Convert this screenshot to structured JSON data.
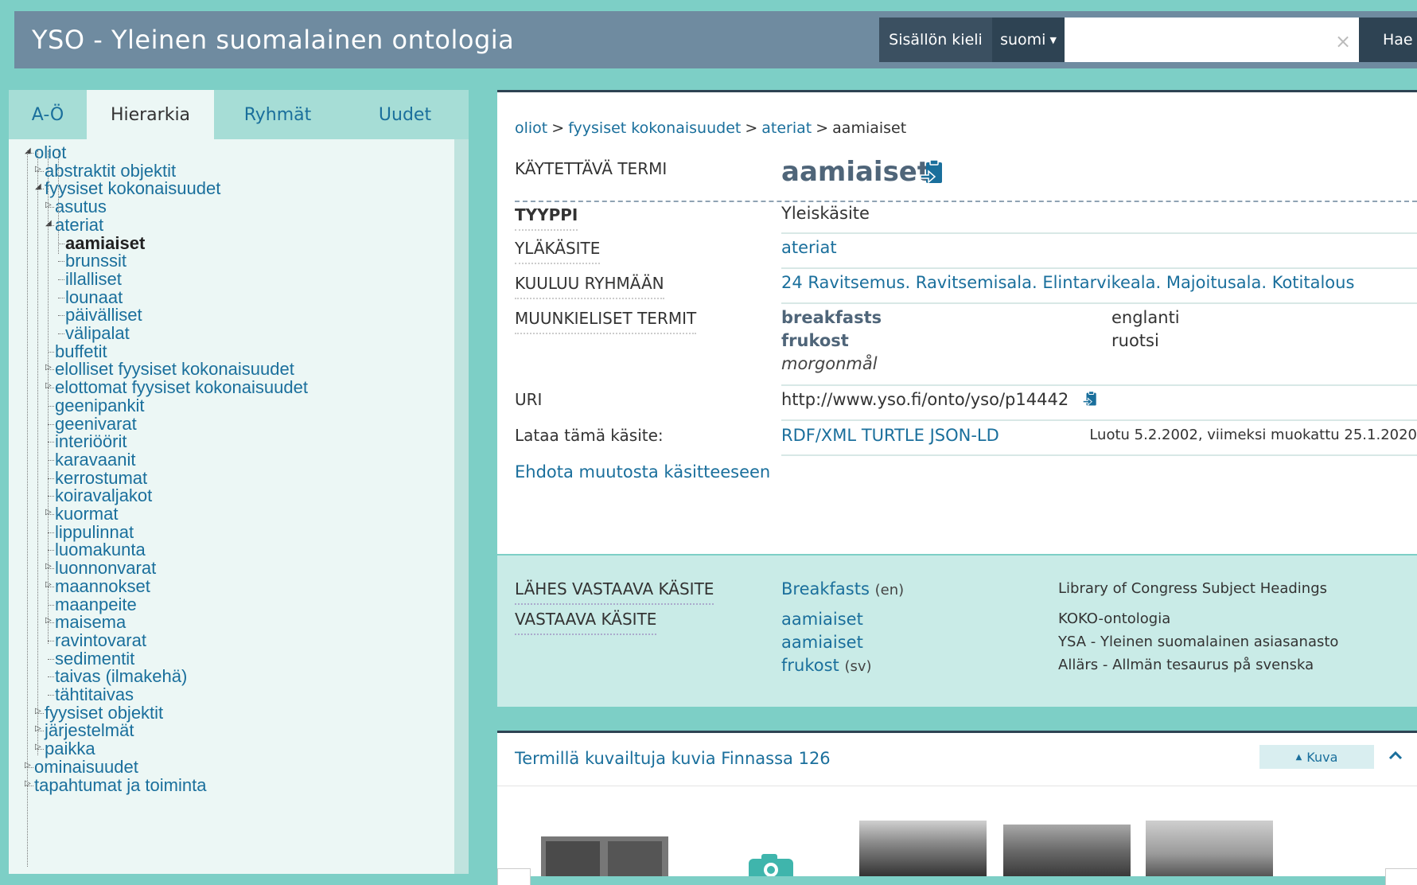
{
  "header": {
    "title": "YSO - Yleinen suomalainen ontologia",
    "content_lang_label": "Sisällön kieli",
    "content_lang_value": "suomi",
    "search_placeholder": "",
    "search_button": "Hae",
    "clear_symbol": "×"
  },
  "sidebar": {
    "tabs": [
      {
        "label": "A-Ö",
        "active": false
      },
      {
        "label": "Hierarkia",
        "active": true
      },
      {
        "label": "Ryhmät",
        "active": false
      },
      {
        "label": "Uudet",
        "active": false
      }
    ],
    "tree": [
      {
        "label": "oliot",
        "level": 0,
        "toggle": "open"
      },
      {
        "label": "abstraktit objektit",
        "level": 1,
        "toggle": "closed"
      },
      {
        "label": "fyysiset kokonaisuudet",
        "level": 1,
        "toggle": "open"
      },
      {
        "label": "asutus",
        "level": 2,
        "toggle": "closed"
      },
      {
        "label": "ateriat",
        "level": 2,
        "toggle": "open"
      },
      {
        "label": "aamiaiset",
        "level": 3,
        "selected": true
      },
      {
        "label": "brunssit",
        "level": 3
      },
      {
        "label": "illalliset",
        "level": 3
      },
      {
        "label": "lounaat",
        "level": 3
      },
      {
        "label": "päivälliset",
        "level": 3
      },
      {
        "label": "välipalat",
        "level": 3
      },
      {
        "label": "buffetit",
        "level": 2
      },
      {
        "label": "elolliset fyysiset kokonaisuudet",
        "level": 2,
        "toggle": "closed"
      },
      {
        "label": "elottomat fyysiset kokonaisuudet",
        "level": 2,
        "toggle": "closed"
      },
      {
        "label": "geenipankit",
        "level": 2
      },
      {
        "label": "geenivarat",
        "level": 2
      },
      {
        "label": "interiöörit",
        "level": 2
      },
      {
        "label": "karavaanit",
        "level": 2
      },
      {
        "label": "kerrostumat",
        "level": 2
      },
      {
        "label": "koiravaljakot",
        "level": 2
      },
      {
        "label": "kuormat",
        "level": 2,
        "toggle": "closed"
      },
      {
        "label": "lippulinnat",
        "level": 2
      },
      {
        "label": "luomakunta",
        "level": 2
      },
      {
        "label": "luonnonvarat",
        "level": 2,
        "toggle": "closed"
      },
      {
        "label": "maannokset",
        "level": 2,
        "toggle": "closed"
      },
      {
        "label": "maanpeite",
        "level": 2
      },
      {
        "label": "maisema",
        "level": 2,
        "toggle": "closed"
      },
      {
        "label": "ravintovarat",
        "level": 2
      },
      {
        "label": "sedimentit",
        "level": 2
      },
      {
        "label": "taivas (ilmakehä)",
        "level": 2
      },
      {
        "label": "tähtitaivas",
        "level": 2
      },
      {
        "label": "fyysiset objektit",
        "level": 1,
        "toggle": "closed"
      },
      {
        "label": "järjestelmät",
        "level": 1,
        "toggle": "closed"
      },
      {
        "label": "paikka",
        "level": 1,
        "toggle": "closed"
      },
      {
        "label": "ominaisuudet",
        "level": 0,
        "toggle": "closed"
      },
      {
        "label": "tapahtumat ja toiminta",
        "level": 0,
        "toggle": "closed"
      }
    ]
  },
  "concept": {
    "breadcrumb": [
      "oliot",
      "fyysiset kokonaisuudet",
      "ateriat",
      "aamiaiset"
    ],
    "breadcrumb_sep": ">",
    "pref_label_title": "KÄYTETTÄVÄ TERMI",
    "pref_label": "aamiaiset",
    "type_title": "TYYPPI",
    "type_value": "Yleiskäsite",
    "broader_title": "YLÄKÄSITE",
    "broader_value": "ateriat",
    "group_title": "KUULUU RYHMÄÄN",
    "group_value": "24 Ravitsemus. Ravitsemisala. Elintarvikeala. Majoitusala. Kotitalous",
    "other_lang_title": "MUUNKIELISET TERMIT",
    "other_lang": [
      {
        "term": "breakfasts",
        "lang": "englanti"
      },
      {
        "term": "frukost",
        "lang": "ruotsi"
      },
      {
        "term": "morgonmål",
        "lang": ""
      }
    ],
    "uri_title": "URI",
    "uri_value": "http://www.yso.fi/onto/yso/p14442",
    "download_title": "Lataa tämä käsite:",
    "download_links": [
      "RDF/XML",
      "TURTLE",
      "JSON-LD"
    ],
    "created_info": "Luotu 5.2.2002, viimeksi muokattu 25.1.2020",
    "suggest_link": "Ehdota muutosta käsitteeseen"
  },
  "mappings": {
    "close_match_title": "LÄHES VASTAAVA KÄSITE",
    "exact_match_title": "VASTAAVA KÄSITE",
    "close": [
      {
        "label": "Breakfasts",
        "lang": "(en)",
        "source": "Library of Congress Subject Headings"
      }
    ],
    "exact": [
      {
        "label": "aamiaiset",
        "lang": "",
        "source": "KOKO-ontologia"
      },
      {
        "label": "aamiaiset",
        "lang": "",
        "source": "YSA - Yleinen suomalainen asiasanasto"
      },
      {
        "label": "frukost",
        "lang": "(sv)",
        "source": "Allärs - Allmän tesaurus på svenska"
      }
    ]
  },
  "finna": {
    "title": "Termillä kuvailtuja kuvia Finnassa 126",
    "kuva_button": "Kuva",
    "kuva_icon": "triangle-up-icon",
    "collapse_icon": "chevron-up-icon"
  },
  "colors": {
    "page_bg": "#7dcfc6",
    "header_bg": "#6f8ba0",
    "link": "#1a6f9c",
    "dark": "#2e4353"
  }
}
